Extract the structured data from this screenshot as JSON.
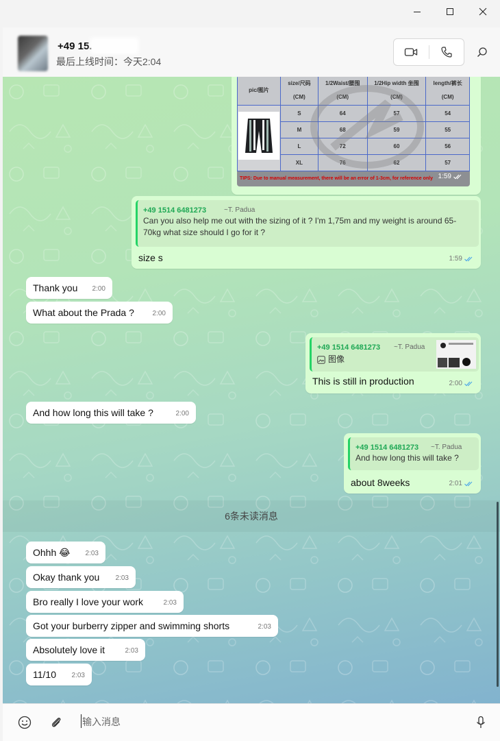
{
  "window": {
    "controls": [
      "minimize",
      "maximize",
      "close"
    ]
  },
  "header": {
    "contact_name": "+49 15.",
    "last_seen": "最后上线时间：今天2:04"
  },
  "size_chart": {
    "header": [
      "pic/图片",
      "size/尺码 (CM)",
      "1/2Waist/腰围 (CM)",
      "1/2Hip width 坐围 (CM)",
      "length/裤长 (CM)"
    ],
    "rows": [
      [
        "S",
        "64",
        "57",
        "54"
      ],
      [
        "M",
        "68",
        "59",
        "55"
      ],
      [
        "L",
        "72",
        "60",
        "56"
      ],
      [
        "XL",
        "76",
        "62",
        "57"
      ]
    ],
    "tips": "TIPS: Due to manual measurement, there will be an error of 1-3cm, for reference only",
    "time": "1:59"
  },
  "messages": {
    "m1": {
      "quote_author": "+49 1514 6481273",
      "quote_handle": "~T. Padua",
      "quote_text": "Can you also help me out with the sizing of it ? I'm 1,75m and my weight is around 65-70kg  what size should I go for it ?",
      "text": "size s",
      "time": "1:59"
    },
    "m2": {
      "text": "Thank you",
      "time": "2:00"
    },
    "m3": {
      "text": "What about the Prada ?",
      "time": "2:00"
    },
    "m4": {
      "quote_author": "+49 1514 6481273",
      "quote_handle": "~T. Padua",
      "quote_text": "图像",
      "text": "This is still in production",
      "time": "2:00"
    },
    "m5": {
      "text": "And how long this will take ?",
      "time": "2:00"
    },
    "m6": {
      "quote_author": "+49 1514 6481273",
      "quote_handle": "~T. Padua",
      "quote_text": "And how long this will take ?",
      "text": "about 8weeks",
      "time": "2:01"
    },
    "unread_divider": "6条未读消息",
    "m7": {
      "text": "Ohhh",
      "emoji": "😂",
      "time": "2:03"
    },
    "m8": {
      "text": "Okay thank you",
      "time": "2:03"
    },
    "m9": {
      "text": "Bro really I love your work",
      "time": "2:03"
    },
    "m10": {
      "text": "Got your burberry zipper and swimming shorts",
      "time": "2:03"
    },
    "m11": {
      "text": "Absolutely love it",
      "time": "2:03"
    },
    "m12": {
      "text": "11/10",
      "time": "2:03"
    }
  },
  "composer": {
    "placeholder": "输入消息"
  },
  "colors": {
    "outgoing_bubble": "#d9fdd3",
    "incoming_bubble": "#ffffff",
    "quote_accent": "#25d366",
    "read_ticks": "#4fa8e8"
  }
}
